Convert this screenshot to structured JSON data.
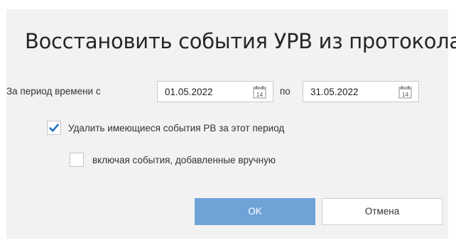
{
  "dialog": {
    "title": "Восстановить события УРВ из протокола",
    "period_label": "За период времени с",
    "date_from": "01.05.2022",
    "to_label": "по",
    "date_to": "31.05.2022",
    "calendar_day": "14",
    "delete_existing": {
      "label": "Удалить имеющиеся события РВ за этот период",
      "checked": true
    },
    "include_manual": {
      "label": "включая события, добавленные вручную",
      "checked": false
    },
    "ok_label": "OK",
    "cancel_label": "Отмена"
  },
  "colors": {
    "accent": "#1a6fc4",
    "ok_button": "#6fa3d8",
    "dialog_bg": "#f2f2f2"
  }
}
